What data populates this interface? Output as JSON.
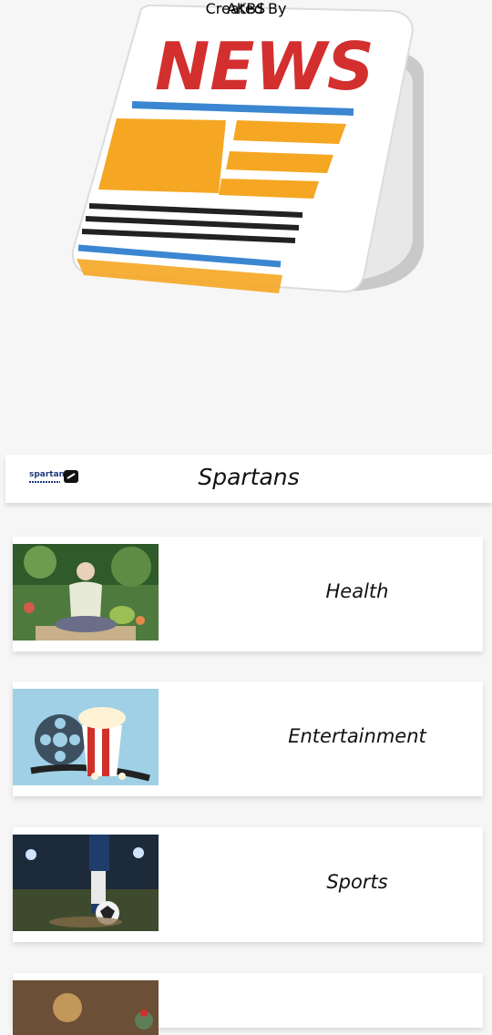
{
  "credits": {
    "created_by_label": "Created By",
    "author": "AKBS"
  },
  "brand": {
    "logo_text": "spartans",
    "title": "Spartans"
  },
  "logo_text": "NEWS",
  "categories": [
    {
      "label": "Health",
      "icon": "meditation-photo"
    },
    {
      "label": "Entertainment",
      "icon": "popcorn-film-photo"
    },
    {
      "label": "Sports",
      "icon": "football-photo"
    },
    {
      "label": "",
      "icon": "science-photo"
    }
  ],
  "colors": {
    "news_red": "#d32f2f",
    "accent_orange": "#f5a623",
    "accent_blue": "#3b86d1"
  }
}
